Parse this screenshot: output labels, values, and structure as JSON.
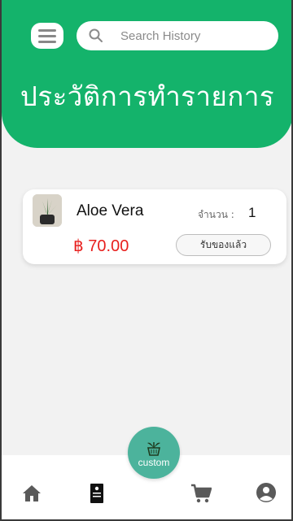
{
  "header": {
    "title": "ประวัติการทำรายการ",
    "menu_icon": "hamburger-menu-icon",
    "color": "#14b36b"
  },
  "search": {
    "placeholder": "Search History",
    "value": "",
    "icon": "search-icon"
  },
  "orders": [
    {
      "name": "Aloe Vera",
      "quantity_label": "จำนวน :",
      "quantity": "1",
      "price": "฿ 70.00",
      "action_label": "รับของแล้ว",
      "image": "aloe-vera-plant-image"
    }
  ],
  "fab": {
    "label": "custom",
    "icon": "plant-pot-icon",
    "color": "#4cb39c"
  },
  "bottom_nav": [
    {
      "icon": "home-icon"
    },
    {
      "icon": "document-icon"
    },
    {
      "icon": "cart-icon"
    },
    {
      "icon": "profile-icon"
    }
  ],
  "colors": {
    "price": "#e8201e",
    "icon_gray": "#5a5a5a"
  }
}
